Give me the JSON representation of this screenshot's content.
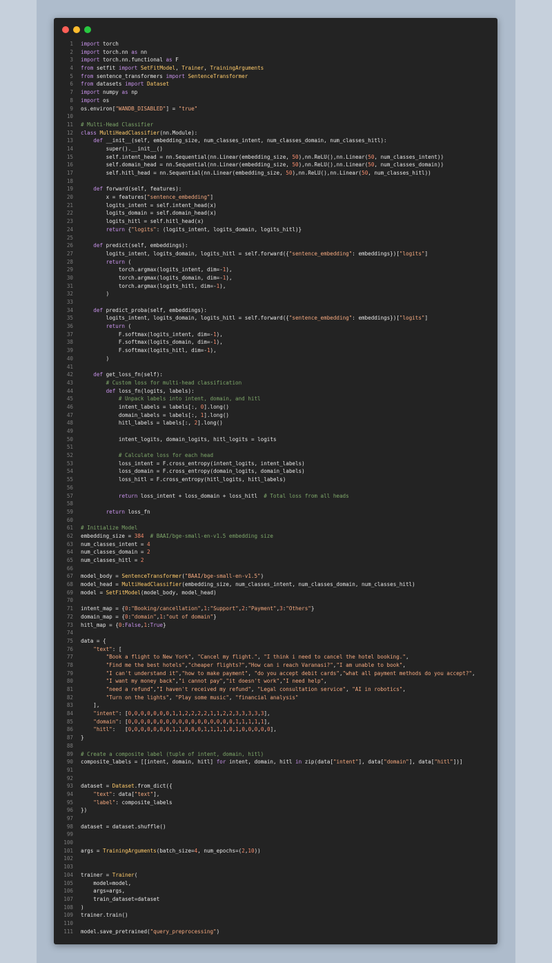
{
  "colors": {
    "background": "#c6d0dc",
    "window": "#232323",
    "close": "#ff5f57",
    "minimize": "#febc2e",
    "maximize": "#28c840"
  },
  "code_lines": [
    "import torch",
    "import torch.nn as nn",
    "import torch.nn.functional as F",
    "from setfit import SetFitModel, Trainer, TrainingArguments",
    "from sentence_transformers import SentenceTransformer",
    "from datasets import Dataset",
    "import numpy as np",
    "import os",
    "os.environ[\"WANDB_DISABLED\"] = \"true\"",
    "",
    "# Multi-Head Classifier",
    "class MultiHeadClassifier(nn.Module):",
    "    def __init__(self, embedding_size, num_classes_intent, num_classes_domain, num_classes_hitl):",
    "        super().__init__()",
    "        self.intent_head = nn.Sequential(nn.Linear(embedding_size, 50),nn.ReLU(),nn.Linear(50, num_classes_intent))",
    "        self.domain_head = nn.Sequential(nn.Linear(embedding_size, 50),nn.ReLU(),nn.Linear(50, num_classes_domain))",
    "        self.hitl_head = nn.Sequential(nn.Linear(embedding_size, 50),nn.ReLU(),nn.Linear(50, num_classes_hitl))",
    "",
    "    def forward(self, features):",
    "        x = features[\"sentence_embedding\"]",
    "        logits_intent = self.intent_head(x)",
    "        logits_domain = self.domain_head(x)",
    "        logits_hitl = self.hitl_head(x)",
    "        return {\"logits\": (logits_intent, logits_domain, logits_hitl)}",
    "",
    "    def predict(self, embeddings):",
    "        logits_intent, logits_domain, logits_hitl = self.forward({\"sentence_embedding\": embeddings})[\"logits\"]",
    "        return (",
    "            torch.argmax(logits_intent, dim=-1),",
    "            torch.argmax(logits_domain, dim=-1),",
    "            torch.argmax(logits_hitl, dim=-1),",
    "        )",
    "",
    "    def predict_proba(self, embeddings):",
    "        logits_intent, logits_domain, logits_hitl = self.forward({\"sentence_embedding\": embeddings})[\"logits\"]",
    "        return (",
    "            F.softmax(logits_intent, dim=-1),",
    "            F.softmax(logits_domain, dim=-1),",
    "            F.softmax(logits_hitl, dim=-1),",
    "        )",
    "",
    "    def get_loss_fn(self):",
    "        # Custom loss for multi-head classification",
    "        def loss_fn(logits, labels):",
    "            # Unpack labels into intent, domain, and hitl",
    "            intent_labels = labels[:, 0].long()",
    "            domain_labels = labels[:, 1].long()",
    "            hitl_labels = labels[:, 2].long()",
    "",
    "            intent_logits, domain_logits, hitl_logits = logits",
    "",
    "            # Calculate loss for each head",
    "            loss_intent = F.cross_entropy(intent_logits, intent_labels)",
    "            loss_domain = F.cross_entropy(domain_logits, domain_labels)",
    "            loss_hitl = F.cross_entropy(hitl_logits, hitl_labels)",
    "",
    "            return loss_intent + loss_domain + loss_hitl  # Total loss from all heads",
    "",
    "        return loss_fn",
    "",
    "# Initialize Model",
    "embedding_size = 384  # BAAI/bge-small-en-v1.5 embedding size",
    "num_classes_intent = 4",
    "num_classes_domain = 2",
    "num_classes_hitl = 2",
    "",
    "model_body = SentenceTransformer(\"BAAI/bge-small-en-v1.5\")",
    "model_head = MultiHeadClassifier(embedding_size, num_classes_intent, num_classes_domain, num_classes_hitl)",
    "model = SetFitModel(model_body, model_head)",
    "",
    "intent_map = {0:\"Booking/cancellation\",1:\"Support\",2:\"Payment\",3:\"Others\"}",
    "domain_map = {0:\"domain\",1:\"out of domain\"}",
    "hitl_map = {0:False,1:True}",
    "",
    "data = {",
    "    \"text\": [",
    "        \"Book a flight to New York\", \"Cancel my flight.\", \"I think i need to cancel the hotel booking.\",",
    "        \"Find me the best hotels\",\"cheaper flights?\",\"How can i reach Varanasi?\",\"I am unable to book\",",
    "        \"I can't understand it\",\"how to make payment\", \"do you accept debit cards\",\"what all payment methods do you accept?\",",
    "        \"I want my money back\",\"i cannot pay\",\"it doesn't work\",\"I need help\",",
    "        \"need a refund\",\"I haven't received my refund\", \"Legal consultation service\", \"AI in robotics\",",
    "        \"Turn on the lights\", \"Play some music\", \"financial analysis\"",
    "    ],",
    "    \"intent\": [0,0,0,0,0,0,0,1,1,2,2,2,2,1,1,2,2,3,3,3,3,3],",
    "    \"domain\": [0,0,0,0,0,0,0,0,0,0,0,0,0,0,0,0,0,1,1,1,1,1],",
    "    \"hitl\":   [0,0,0,0,0,0,0,1,1,0,0,0,1,1,1,1,0,1,0,0,0,0,0],",
    "}",
    "",
    "# Create a composite label (tuple of intent, domain, hitl)",
    "composite_labels = [[intent, domain, hitl] for intent, domain, hitl in zip(data[\"intent\"], data[\"domain\"], data[\"hitl\"])]",
    "",
    "",
    "dataset = Dataset.from_dict({",
    "    \"text\": data[\"text\"],",
    "    \"label\": composite_labels",
    "})",
    "",
    "dataset = dataset.shuffle()",
    "",
    "",
    "args = TrainingArguments(batch_size=4, num_epochs=(2,10))",
    "",
    "",
    "trainer = Trainer(",
    "    model=model,",
    "    args=args,",
    "    train_dataset=dataset",
    ")",
    "trainer.train()",
    "",
    "model.save_pretrained(\"query_preprocessing\")"
  ]
}
